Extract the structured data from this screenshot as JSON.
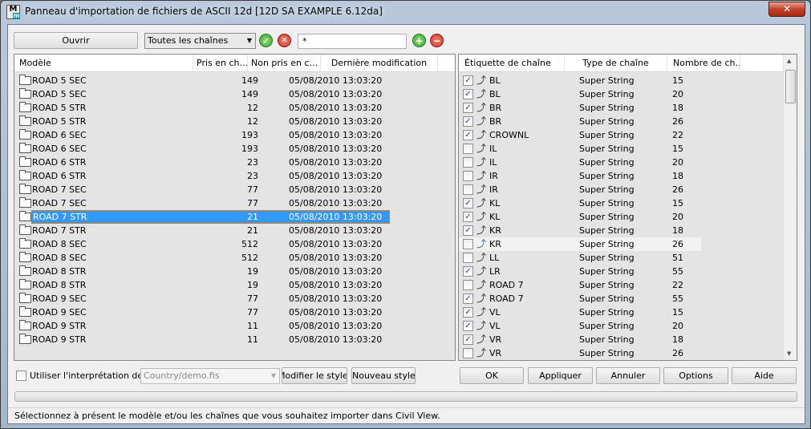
{
  "window": {
    "title": "Panneau d'importation de fichiers de ASCII 12d [12D SA EXAMPLE 6.12da]",
    "app_icon_text": "M",
    "close_label": "✕"
  },
  "toolbar": {
    "open_label": "Ouvrir",
    "filter_value": "Toutes les chaînes",
    "pattern_value": "*"
  },
  "models": {
    "columns": [
      "Modèle",
      "Pris en ch…",
      "Non pris en c…",
      "Dernière modification"
    ],
    "selected_index": 10,
    "rows": [
      {
        "name": "ROAD 5 SEC",
        "taken": "149",
        "date": "05/08/2010 13:03:20"
      },
      {
        "name": "ROAD 5 SEC",
        "taken": "149",
        "date": "05/08/2010 13:03:20"
      },
      {
        "name": "ROAD 5 STR",
        "taken": "12",
        "date": "05/08/2010 13:03:20"
      },
      {
        "name": "ROAD 5 STR",
        "taken": "12",
        "date": "05/08/2010 13:03:20"
      },
      {
        "name": "ROAD 6 SEC",
        "taken": "193",
        "date": "05/08/2010 13:03:20"
      },
      {
        "name": "ROAD 6 SEC",
        "taken": "193",
        "date": "05/08/2010 13:03:20"
      },
      {
        "name": "ROAD 6 STR",
        "taken": "23",
        "date": "05/08/2010 13:03:20"
      },
      {
        "name": "ROAD 6 STR",
        "taken": "23",
        "date": "05/08/2010 13:03:20"
      },
      {
        "name": "ROAD 7 SEC",
        "taken": "77",
        "date": "05/08/2010 13:03:20"
      },
      {
        "name": "ROAD 7 SEC",
        "taken": "77",
        "date": "05/08/2010 13:03:20"
      },
      {
        "name": "ROAD 7 STR",
        "taken": "21",
        "date": "05/08/2010 13:03:20"
      },
      {
        "name": "ROAD 7 STR",
        "taken": "21",
        "date": "05/08/2010 13:03:20"
      },
      {
        "name": "ROAD 8 SEC",
        "taken": "512",
        "date": "05/08/2010 13:03:20"
      },
      {
        "name": "ROAD 8 SEC",
        "taken": "512",
        "date": "05/08/2010 13:03:20"
      },
      {
        "name": "ROAD 8 STR",
        "taken": "19",
        "date": "05/08/2010 13:03:20"
      },
      {
        "name": "ROAD 8 STR",
        "taken": "19",
        "date": "05/08/2010 13:03:20"
      },
      {
        "name": "ROAD 9 SEC",
        "taken": "77",
        "date": "05/08/2010 13:03:20"
      },
      {
        "name": "ROAD 9 SEC",
        "taken": "77",
        "date": "05/08/2010 13:03:20"
      },
      {
        "name": "ROAD 9 STR",
        "taken": "11",
        "date": "05/08/2010 13:03:20"
      },
      {
        "name": "ROAD 9 STR",
        "taken": "11",
        "date": "05/08/2010 13:03:20"
      }
    ]
  },
  "strings": {
    "columns": [
      "Étiquette de chaîne",
      "Type de chaîne",
      "Nombre de ch…"
    ],
    "hover_index": 12,
    "rows": [
      {
        "checked": true,
        "label": "BL",
        "type": "Super String",
        "count": "15"
      },
      {
        "checked": true,
        "label": "BL",
        "type": "Super String",
        "count": "20"
      },
      {
        "checked": true,
        "label": "BR",
        "type": "Super String",
        "count": "18"
      },
      {
        "checked": true,
        "label": "BR",
        "type": "Super String",
        "count": "26"
      },
      {
        "checked": true,
        "label": "CROWNL",
        "type": "Super String",
        "count": "22"
      },
      {
        "checked": false,
        "label": "IL",
        "type": "Super String",
        "count": "15"
      },
      {
        "checked": false,
        "label": "IL",
        "type": "Super String",
        "count": "20"
      },
      {
        "checked": false,
        "label": "IR",
        "type": "Super String",
        "count": "18"
      },
      {
        "checked": false,
        "label": "IR",
        "type": "Super String",
        "count": "26"
      },
      {
        "checked": true,
        "label": "KL",
        "type": "Super String",
        "count": "15"
      },
      {
        "checked": true,
        "label": "KL",
        "type": "Super String",
        "count": "20"
      },
      {
        "checked": true,
        "label": "KR",
        "type": "Super String",
        "count": "18"
      },
      {
        "checked": false,
        "label": "KR",
        "type": "Super String",
        "count": "26"
      },
      {
        "checked": false,
        "label": "LL",
        "type": "Super String",
        "count": "51"
      },
      {
        "checked": true,
        "label": "LR",
        "type": "Super String",
        "count": "55"
      },
      {
        "checked": false,
        "label": "ROAD 7",
        "type": "Super String",
        "count": "22"
      },
      {
        "checked": true,
        "label": "ROAD 7",
        "type": "Super String",
        "count": "55"
      },
      {
        "checked": true,
        "label": "VL",
        "type": "Super String",
        "count": "15"
      },
      {
        "checked": true,
        "label": "VL",
        "type": "Super String",
        "count": "20"
      },
      {
        "checked": true,
        "label": "VR",
        "type": "Super String",
        "count": "18"
      },
      {
        "checked": false,
        "label": "VR",
        "type": "Super String",
        "count": "26"
      }
    ]
  },
  "bottom": {
    "use_interp_label": "Utiliser l'interprétation de",
    "use_interp_checked": false,
    "style_file": "Country/demo.fis",
    "modify_style": "Modifier le style..",
    "new_style": "Nouveau style...",
    "ok": "OK",
    "apply": "Appliquer",
    "cancel": "Annuler",
    "options": "Options",
    "help": "Aide"
  },
  "status": "Sélectionnez à présent le modèle et/ou les chaînes que vous souhaitez importer dans Civil View.",
  "colors": {
    "selection": "#3399ff",
    "ok_green": "#3aa63a",
    "cancel_red": "#d9342b"
  }
}
